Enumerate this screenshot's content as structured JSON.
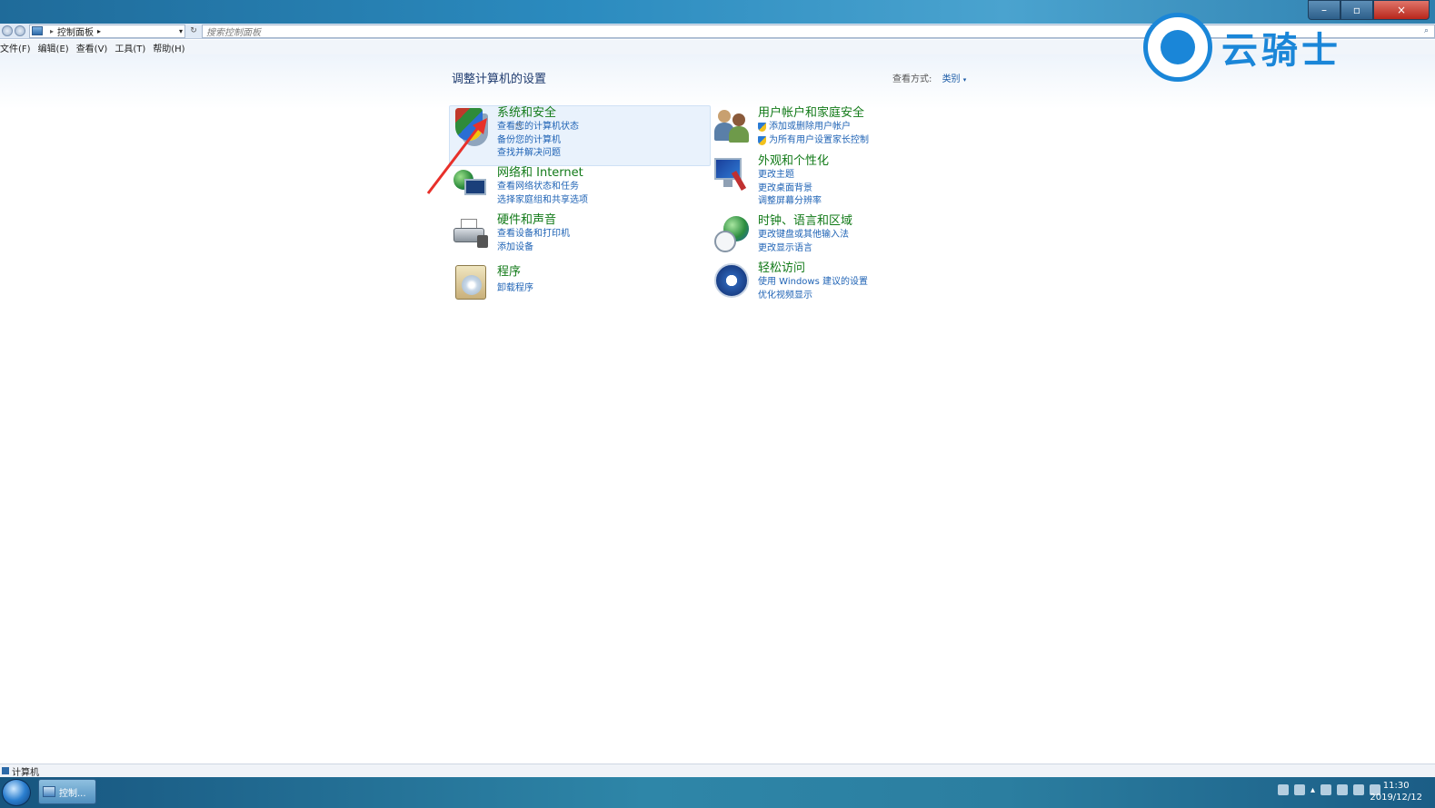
{
  "window": {
    "controls": {
      "minimize": "–",
      "maximize": "▫",
      "close": "×"
    }
  },
  "address": {
    "breadcrumb": "控制面板",
    "search_placeholder": "搜索控制面板"
  },
  "menu": [
    "文件(F)",
    "编辑(E)",
    "查看(V)",
    "工具(T)",
    "帮助(H)"
  ],
  "watermark": {
    "text": "云骑士"
  },
  "main": {
    "title": "调整计算机的设置",
    "view_mode_label": "查看方式:",
    "view_mode_value": "类别",
    "categories_left": [
      {
        "title": "系统和安全",
        "icon": "shield-icon",
        "links": [
          "查看您的计算机状态",
          "备份您的计算机",
          "查找并解决问题"
        ]
      },
      {
        "title": "网络和 Internet",
        "icon": "network-icon",
        "links": [
          "查看网络状态和任务",
          "选择家庭组和共享选项"
        ]
      },
      {
        "title": "硬件和声音",
        "icon": "printer-icon",
        "links": [
          "查看设备和打印机",
          "添加设备"
        ]
      },
      {
        "title": "程序",
        "icon": "programs-icon",
        "links": [
          "卸载程序"
        ]
      }
    ],
    "categories_right": [
      {
        "title": "用户帐户和家庭安全",
        "icon": "users-icon",
        "links": [
          "添加或删除用户帐户",
          "为所有用户设置家长控制"
        ]
      },
      {
        "title": "外观和个性化",
        "icon": "appearance-icon",
        "links": [
          "更改主题",
          "更改桌面背景",
          "调整屏幕分辨率"
        ]
      },
      {
        "title": "时钟、语言和区域",
        "icon": "clock-globe-icon",
        "links": [
          "更改键盘或其他输入法",
          "更改显示语言"
        ]
      },
      {
        "title": "轻松访问",
        "icon": "ease-of-access-icon",
        "links": [
          "使用 Windows 建议的设置",
          "优化视频显示"
        ]
      }
    ]
  },
  "status": {
    "text": "计算机"
  },
  "taskbar": {
    "task_label": "控制...",
    "time": "11:30",
    "date": "2019/12/12"
  },
  "colors": {
    "category_title": "#127a18",
    "link": "#1f63b5",
    "page_title": "#1e3a6e",
    "annotation_arrow": "#e8302a",
    "watermark": "#1a86d8"
  }
}
